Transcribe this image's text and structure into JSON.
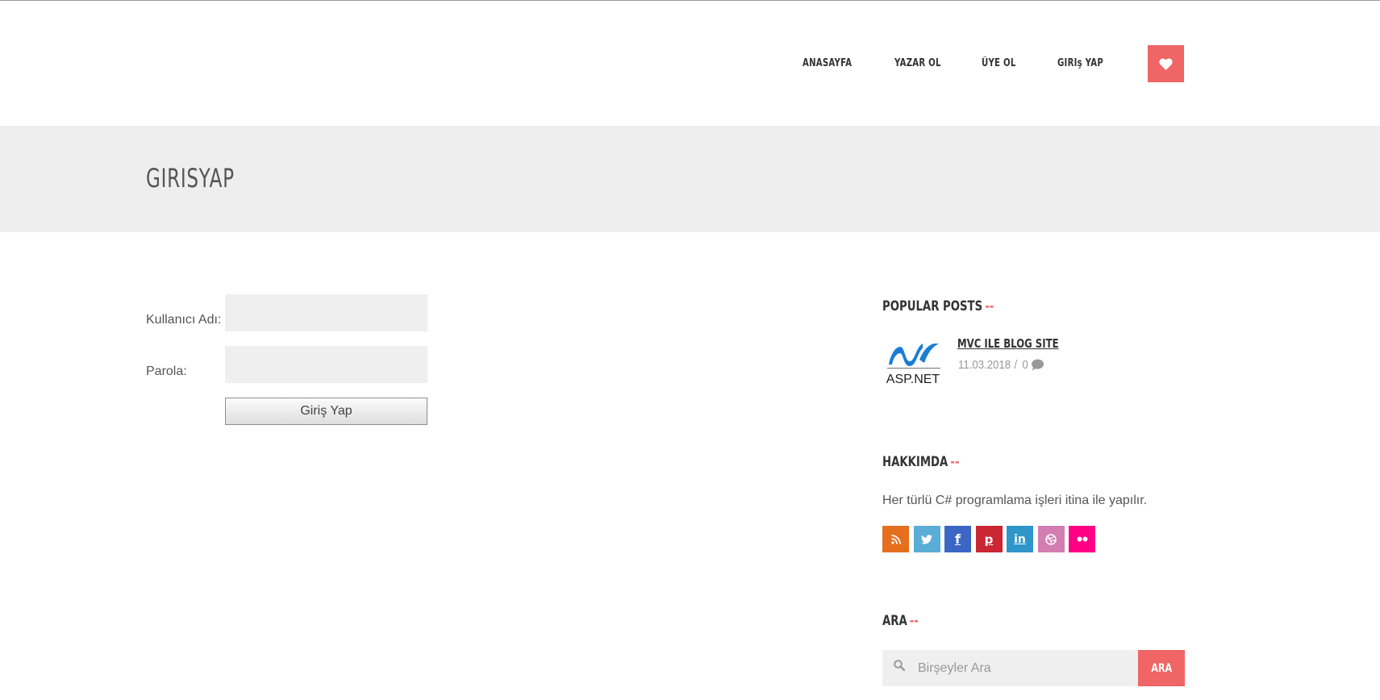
{
  "nav": {
    "items": [
      "ANASAYFA",
      "YAZAR OL",
      "ÜYE OL",
      "GIRIş YAP"
    ],
    "heart_icon": "heart-icon",
    "accent": "#f06565"
  },
  "page": {
    "title": "GIRISYAP"
  },
  "login": {
    "username_label": "Kullanıcı Adı:",
    "password_label": "Parola:",
    "username_value": "",
    "password_value": "",
    "submit_label": "Giriş Yap"
  },
  "sidebar": {
    "popular": {
      "title": "POPULAR POSTS",
      "dash": "--",
      "posts": [
        {
          "title": "MVC ILE BLOG SITE",
          "date": "11.03.2018",
          "sep": "/",
          "comments": "0",
          "thumb_text": "ASP.NET"
        }
      ]
    },
    "about": {
      "title": "HAKKIMDA",
      "dash": "--",
      "text": "Her türlü C# programlama işleri itina ile yapılır.",
      "socials": [
        {
          "name": "rss-icon",
          "color": "#e66f1e"
        },
        {
          "name": "twitter-icon",
          "color": "#5aadd6"
        },
        {
          "name": "facebook-icon",
          "color": "#3b66c4"
        },
        {
          "name": "pinterest-icon",
          "color": "#cb2634"
        },
        {
          "name": "linkedin-icon",
          "color": "#2e96c9"
        },
        {
          "name": "dribbble-icon",
          "color": "#d47db3"
        },
        {
          "name": "flickr-icon",
          "color": "#ff0084"
        }
      ]
    },
    "search": {
      "title": "ARA",
      "dash": "--",
      "placeholder": "Birşeyler Ara",
      "button": "ARA"
    }
  }
}
